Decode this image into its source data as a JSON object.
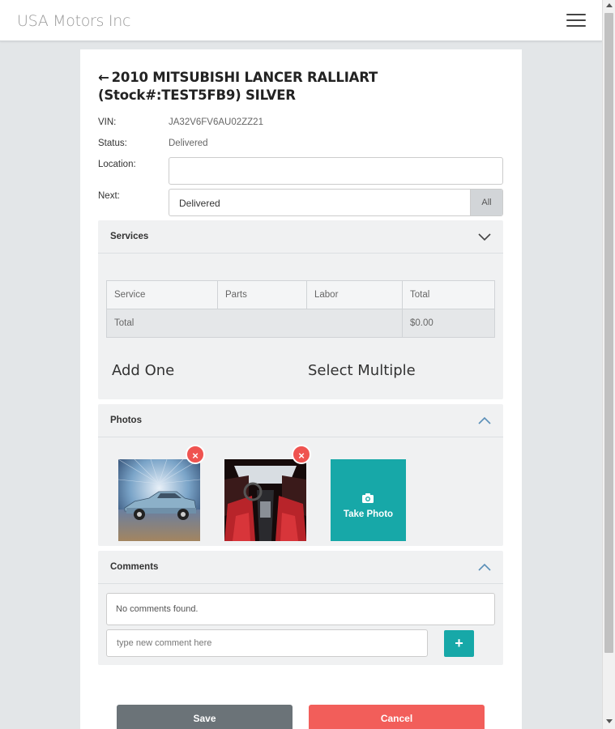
{
  "app": {
    "brand": "USA Motors Inc"
  },
  "vehicle": {
    "back_arrow": "←",
    "title": "2010 MITSUBISHI LANCER RALLIART (Stock#:TEST5FB9) SILVER"
  },
  "fields": {
    "vin_label": "VIN:",
    "vin_value": "JA32V6FV6AU02ZZ21",
    "status_label": "Status:",
    "status_value": "Delivered",
    "location_label": "Location:",
    "location_value": "",
    "next_label": "Next:",
    "next_value": "Delivered",
    "next_all": "All"
  },
  "services": {
    "title": "Services",
    "columns": [
      "Service",
      "Parts",
      "Labor",
      "Total"
    ],
    "total_label": "Total",
    "total_value": "$0.00",
    "add_one": "Add One",
    "select_multiple": "Select Multiple"
  },
  "photos": {
    "title": "Photos",
    "delete_symbol": "×",
    "take_photo": "Take Photo"
  },
  "comments": {
    "title": "Comments",
    "empty": "No comments found.",
    "placeholder": "type new comment here",
    "add_symbol": "+"
  },
  "actions": {
    "save": "Save",
    "cancel": "Cancel"
  },
  "colors": {
    "accent": "#17a8a8",
    "danger": "#ef5350",
    "save": "#6b7378"
  }
}
